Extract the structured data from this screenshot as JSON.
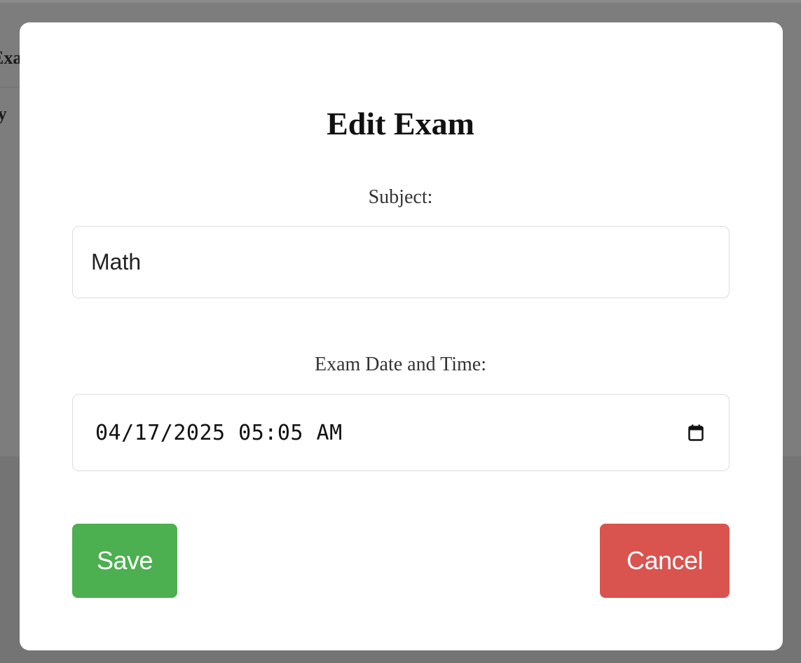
{
  "background": {
    "partial_text_top": "Exam",
    "partial_text_bottom": "ty"
  },
  "modal": {
    "title": "Edit Exam",
    "subject_label": "Subject:",
    "subject_value": "Math",
    "datetime_label": "Exam Date and Time:",
    "datetime_value": "04/17/2025 05:05 AM",
    "calendar_icon": "calendar-icon",
    "save_label": "Save",
    "cancel_label": "Cancel"
  },
  "colors": {
    "save": "#4caf50",
    "cancel": "#d9534f",
    "overlay": "#808080"
  }
}
